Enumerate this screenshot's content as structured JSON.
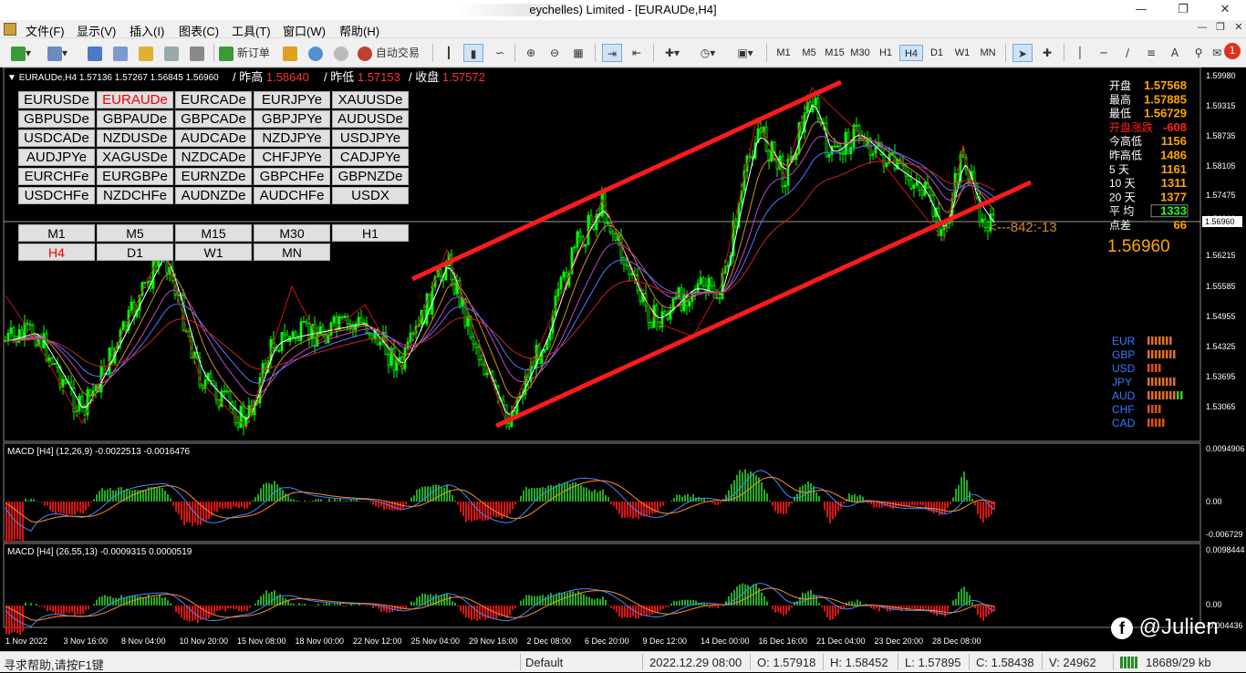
{
  "window": {
    "title": "eychelles) Limited - [EURAUDe,H4]"
  },
  "menu": [
    "文件(F)",
    "显示(V)",
    "插入(I)",
    "图表(C)",
    "工具(T)",
    "窗口(W)",
    "帮助(H)"
  ],
  "toolbar": {
    "new_order": "新订单",
    "auto_trading": "自动交易",
    "timeframes": [
      "M1",
      "M5",
      "M15",
      "M30",
      "H1",
      "H4",
      "D1",
      "W1",
      "MN"
    ],
    "selected_timeframe": "H4",
    "notification_count": "1"
  },
  "chart": {
    "header": "EURAUDe,H4  1.57136 1.57267 1.56845 1.56960",
    "prev_high_label": "/ 昨高",
    "prev_high": "1.58640",
    "prev_low_label": "/ 昨低",
    "prev_low": "1.57153",
    "prev_close_label": "/ 收盘",
    "prev_close": "1.57572",
    "price_axis": [
      "1.59980",
      "1.59315",
      "1.58735",
      "1.58105",
      "1.57475",
      "1.56960",
      "1.56215",
      "1.55585",
      "1.54955",
      "1.54325",
      "1.53695",
      "1.53065"
    ],
    "current_price_tag": "1.56960",
    "time_axis": [
      "1 Nov 2022",
      "3 Nov 16:00",
      "8 Nov 04:00",
      "10 Nov 20:00",
      "15 Nov 08:00",
      "18 Nov 00:00",
      "22 Nov 12:00",
      "25 Nov 04:00",
      "29 Nov 16:00",
      "2 Dec 08:00",
      "6 Dec 20:00",
      "9 Dec 12:00",
      "14 Dec 00:00",
      "16 Dec 16:00",
      "21 Dec 04:00",
      "23 Dec 20:00",
      "28 Dec 08:00"
    ],
    "spread_marker": "<---842:-13",
    "macd1_label": "MACD [H4] (12,26,9) -0.0022513 -0.0016476",
    "macd1_axis": [
      "0.0094906",
      "0.00",
      "-0.006729"
    ],
    "macd2_label": "MACD [H4] (26,55,13) -0.0009315 0.0000519",
    "macd2_axis": [
      "0.0098444",
      "0.00",
      "-0.004436"
    ]
  },
  "symbols": [
    [
      "EURUSDe",
      "EURAUDe",
      "EURCADe",
      "EURJPYe",
      "XAUUSDe"
    ],
    [
      "GBPUSDe",
      "GBPAUDe",
      "GBPCADe",
      "GBPJPYe",
      "AUDUSDe"
    ],
    [
      "USDCADe",
      "NZDUSDe",
      "AUDCADe",
      "NZDJPYe",
      "USDJPYe"
    ],
    [
      "AUDJPYe",
      "XAGUSDe",
      "NZDCADe",
      "CHFJPYe",
      "CADJPYe"
    ],
    [
      "EURCHFe",
      "EURGBPe",
      "EURNZDe",
      "GBPCHFe",
      "GBPNZDe"
    ],
    [
      "USDCHFe",
      "NZDCHFe",
      "AUDNZDe",
      "AUDCHFe",
      "USDX"
    ]
  ],
  "selected_symbol": "EURAUDe",
  "tf_buttons": [
    [
      "M1",
      "M5",
      "M15",
      "M30",
      "H1"
    ],
    [
      "H4",
      "D1",
      "W1",
      "MN"
    ]
  ],
  "selected_tf_button": "H4",
  "info_panel": {
    "rows": [
      {
        "label": "开盘",
        "value": "1.57568"
      },
      {
        "label": "最高",
        "value": "1.57885"
      },
      {
        "label": "最低",
        "value": "1.56729"
      },
      {
        "label": "开盘涨跌",
        "value": "-608"
      },
      {
        "label": "今高低",
        "value": "1156"
      },
      {
        "label": "昨高低",
        "value": "1486"
      },
      {
        "label": "5   天",
        "value": "1161"
      },
      {
        "label": "10  天",
        "value": "1311"
      },
      {
        "label": "20  天",
        "value": "1377"
      },
      {
        "label": "平   均",
        "value": "1333"
      },
      {
        "label": "点差",
        "value": "66"
      }
    ],
    "big_price": "1.56960"
  },
  "strength": [
    {
      "ccy": "EUR",
      "bars": 7,
      "color": "#e07020"
    },
    {
      "ccy": "GBP",
      "bars": 8,
      "color": "#e07020"
    },
    {
      "ccy": "USD",
      "bars": 4,
      "color": "#e05010"
    },
    {
      "ccy": "JPY",
      "bars": 8,
      "color": "#e07020"
    },
    {
      "ccy": "AUD",
      "bars": 10,
      "color": "#e07020"
    },
    {
      "ccy": "CHF",
      "bars": 4,
      "color": "#e05010"
    },
    {
      "ccy": "CAD",
      "bars": 5,
      "color": "#e05010"
    }
  ],
  "status": {
    "help": "寻求帮助,请按F1键",
    "profile": "Default",
    "datetime": "2022.12.29 08:00",
    "open": "O: 1.57918",
    "high": "H: 1.58452",
    "low": "L: 1.57895",
    "close": "C: 1.58438",
    "volume": "V: 24962",
    "traffic": "18689/29 kb"
  },
  "watermark": "@Julien",
  "colors": {
    "bull": "#00ff00",
    "bear": "#00ff00",
    "channel": "#ff1a1a",
    "accent_red": "#ff3030",
    "gold": "#ffa500"
  }
}
